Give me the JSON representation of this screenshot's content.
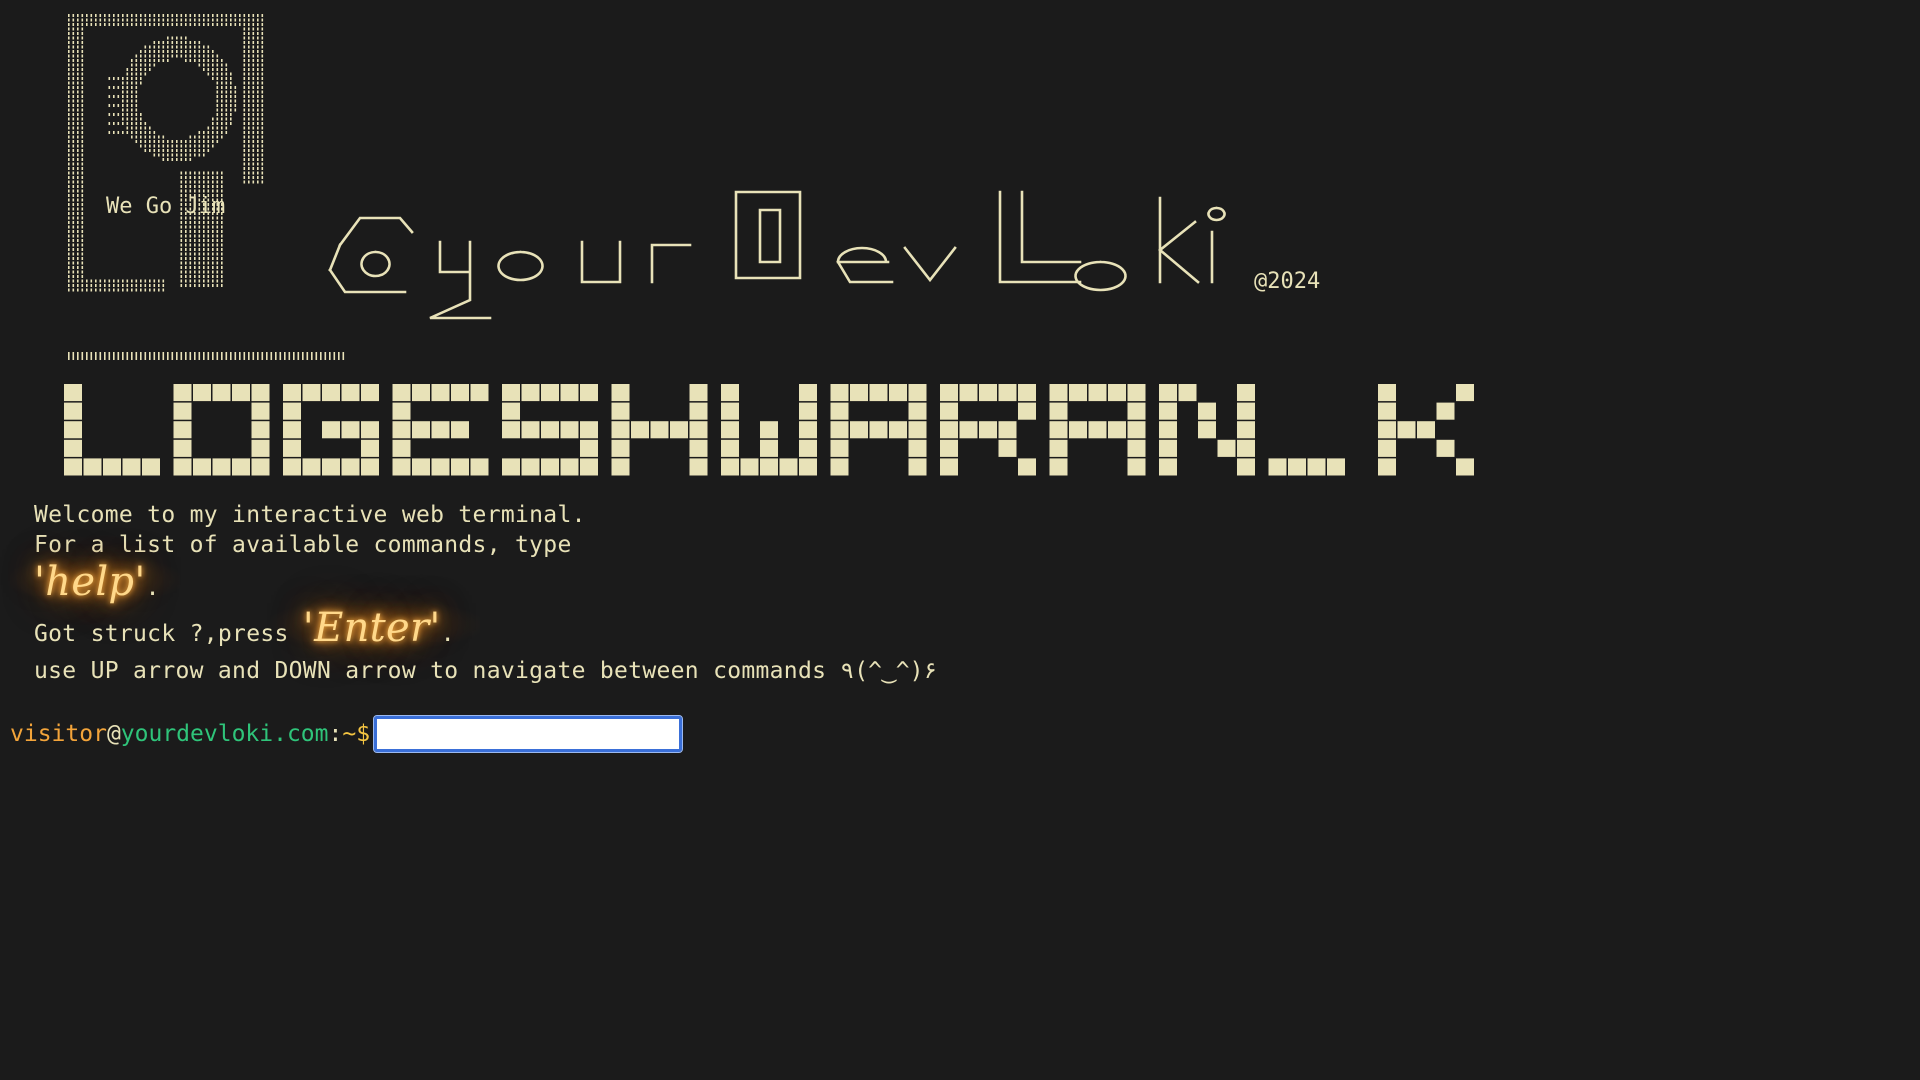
{
  "banner": {
    "art_caption": "We Go Jim",
    "logo_text": "@yourDevLoki",
    "year": "@2024",
    "name_block": "LOGESHWARAN.K"
  },
  "intro": {
    "line1": "Welcome to my interactive web terminal.",
    "line2": "For a list of available commands, type",
    "help_word": "'help'",
    "help_suffix": ".",
    "stuck_prefix": "Got struck ?,press ",
    "enter_word": "'Enter'",
    "enter_suffix": ".",
    "nav_hint": "use UP arrow and DOWN arrow to navigate between commands ٩(^‿^)۶"
  },
  "prompt": {
    "user": "visitor",
    "at": "@",
    "host": "yourdevloki.com",
    "colon": ":",
    "path": "~",
    "dollar": "$",
    "input_value": ""
  },
  "colors": {
    "background": "#1b1b1b",
    "text": "#e8e2b8",
    "user": "#f3a43a",
    "host": "#2fc47a",
    "path": "#f5c542",
    "neon": "#ffb347",
    "input_border": "#3a6fd8"
  }
}
